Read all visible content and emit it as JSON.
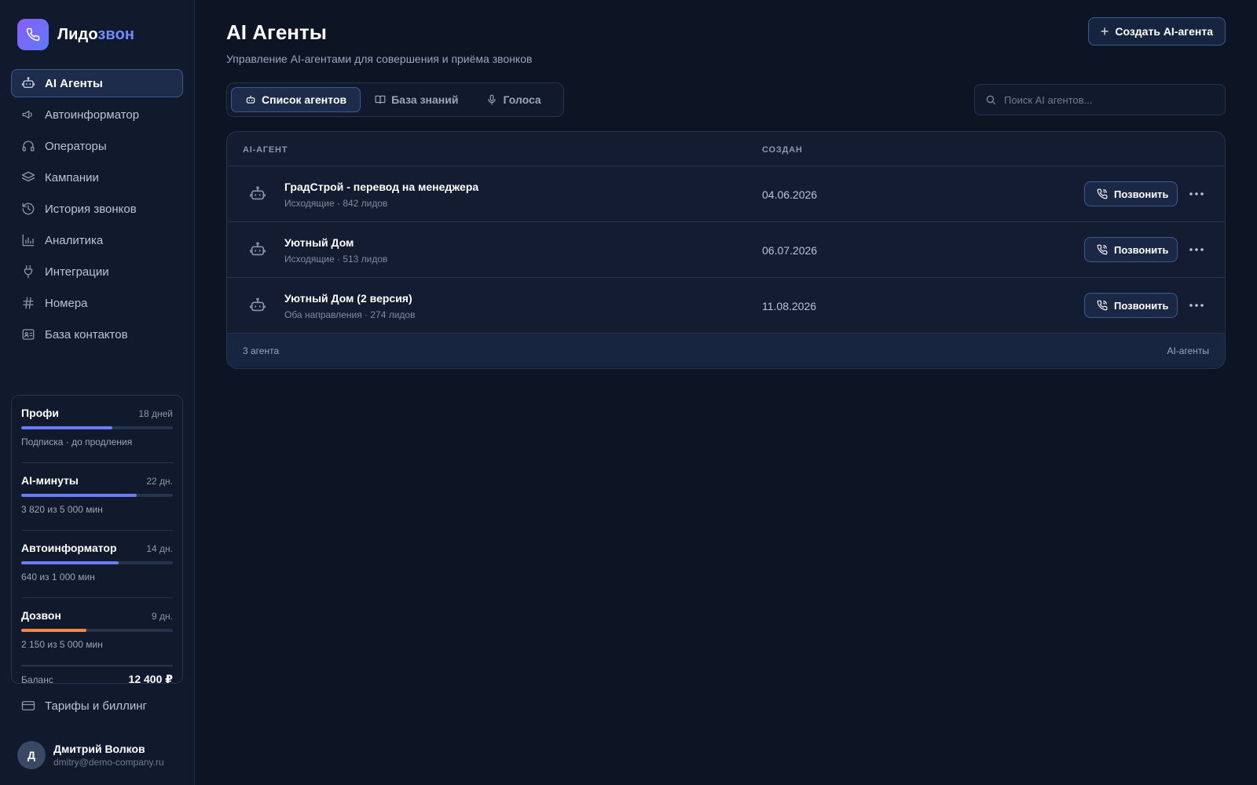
{
  "brand": {
    "name_main": "Лидо",
    "name_accent": "звон"
  },
  "sidebar": {
    "items": [
      {
        "label": "AI Агенты",
        "icon": "bot-icon",
        "active": true
      },
      {
        "label": "Автоинформатор",
        "icon": "megaphone-icon"
      },
      {
        "label": "Операторы",
        "icon": "headset-icon"
      },
      {
        "label": "Кампании",
        "icon": "layers-icon"
      },
      {
        "label": "История звонков",
        "icon": "history-icon"
      },
      {
        "label": "Аналитика",
        "icon": "chart-icon"
      },
      {
        "label": "Интеграции",
        "icon": "plug-icon"
      },
      {
        "label": "Номера",
        "icon": "hash-icon"
      },
      {
        "label": "База контактов",
        "icon": "contact-card-icon"
      }
    ],
    "plans": [
      {
        "name": "Профи",
        "days": "18 дней",
        "sub": "Подписка · до продления",
        "fill": 0.6,
        "color": "#6b7cf6"
      },
      {
        "name": "AI-минуты",
        "days": "22 дн.",
        "sub": "3 820 из 5 000 мин",
        "fill": 0.76,
        "color": "#6b7cf6"
      },
      {
        "name": "Автоинформатор",
        "days": "14 дн.",
        "sub": "640 из 1 000 мин",
        "fill": 0.64,
        "color": "#6b7cf6"
      },
      {
        "name": "Дозвон",
        "days": "9 дн.",
        "sub": "2 150 из 5 000 мин",
        "fill": 0.43,
        "color": "#f4884a"
      }
    ],
    "balance_label": "Баланс",
    "balance_value": "12 400 ₽",
    "billing_label": "Тарифы и биллинг",
    "user": {
      "initial": "Д",
      "name": "Дмитрий Волков",
      "email": "dmitry@demo-company.ru"
    }
  },
  "header": {
    "title": "AI Агенты",
    "subtitle": "Управление AI-агентами для совершения и приёма звонков",
    "create_label": "Создать AI-агента"
  },
  "tabs": [
    {
      "label": "Список агентов",
      "icon": "bot-icon",
      "active": true
    },
    {
      "label": "База знаний",
      "icon": "book-icon"
    },
    {
      "label": "Голоса",
      "icon": "mic-icon"
    }
  ],
  "search": {
    "placeholder": "Поиск AI агентов..."
  },
  "table": {
    "columns": [
      "AI-АГЕНТ",
      "СОЗДАН"
    ],
    "rows": [
      {
        "name": "ГрадСтрой - перевод на менеджера",
        "meta": "Исходящие · 842 лидов",
        "created": "04.06.2026"
      },
      {
        "name": "Уютный Дом",
        "meta": "Исходящие · 513 лидов",
        "created": "06.07.2026"
      },
      {
        "name": "Уютный Дом (2 версия)",
        "meta": "Оба направления · 274 лидов",
        "created": "11.08.2026"
      }
    ],
    "call_label": "Позвонить",
    "footer_count": "3 агента",
    "footer_label": "AI-агенты"
  },
  "colors": {
    "accent": "#6b8cff",
    "background": "#0d1424",
    "sidebar": "#111a2c",
    "border_active": "#3b5a92"
  }
}
